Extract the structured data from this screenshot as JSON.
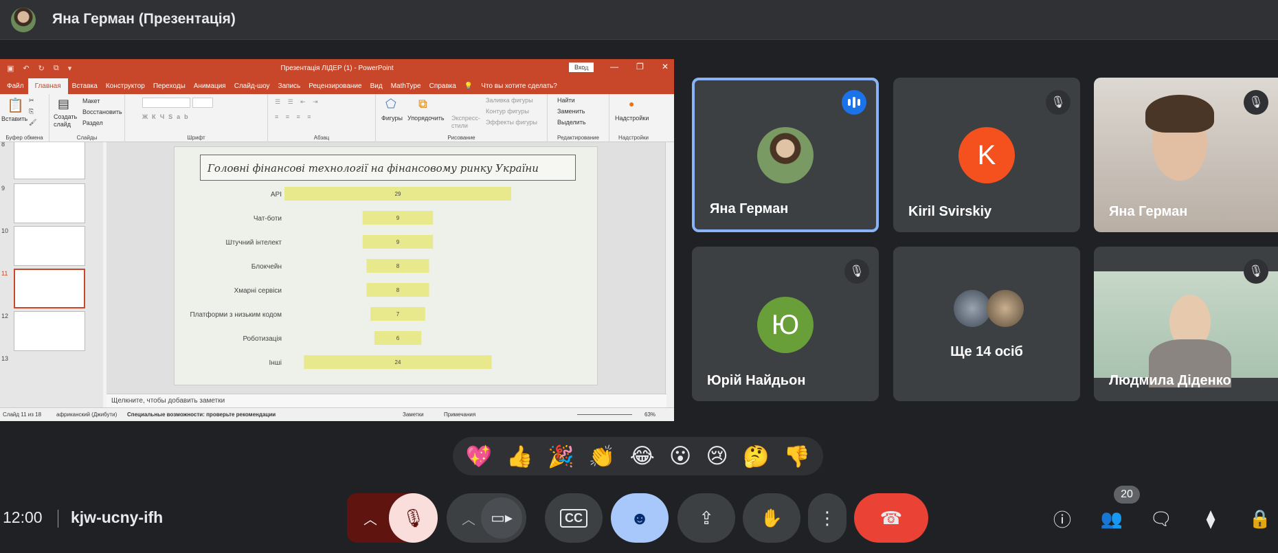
{
  "presenter": {
    "title": "Яна Герман (Презентація)"
  },
  "ppt": {
    "window_title": "Презентація ЛІДЕР (1)  -  PowerPoint",
    "signin": "Вход",
    "tabs": [
      "Файл",
      "Главная",
      "Вставка",
      "Конструктор",
      "Переходы",
      "Анимация",
      "Слайд-шоу",
      "Запись",
      "Рецензирование",
      "Вид",
      "MathType",
      "Справка",
      "Что вы хотите сделать?"
    ],
    "ribbon": {
      "paste": "Вставить",
      "clipboard": "Буфер обмена",
      "new_slide": "Создать слайд",
      "layout": "Макет",
      "reset": "Восстановить",
      "section": "Раздел",
      "slides": "Слайды",
      "font": "Шрифт",
      "paragraph": "Абзац",
      "shapes": "Фигуры",
      "arrange": "Упорядочить",
      "quick_styles": "Экспресс-стили",
      "shape_fill": "Заливка фигуры",
      "shape_outline": "Контур фигуры",
      "shape_effects": "Эффекты фигуры",
      "drawing": "Рисование",
      "find": "Найти",
      "replace": "Заменить",
      "select": "Выделить",
      "editing": "Редактирование",
      "addins_btn": "Надстройки",
      "addins": "Надстройки"
    },
    "thumb_numbers": [
      "8",
      "9",
      "10",
      "11",
      "12",
      "13"
    ],
    "notes": "Щелкните, чтобы добавить заметки",
    "status": {
      "slide": "Слайд 11 из 18",
      "lang": "африканский (Джибути)",
      "accessibility": "Специальные возможности: проверьте рекомендации",
      "notes_btn": "Заметки",
      "comments_btn": "Примечания",
      "zoom": "63%"
    }
  },
  "chart_data": {
    "type": "bar",
    "title": "Головні фінансові технології на фінансовому ринку України",
    "categories": [
      "API",
      "Чат-боти",
      "Штучний інтелект",
      "Блокчейн",
      "Хмарні сервіси",
      "Платформи з низьким кодом",
      "Роботизація",
      "Інші"
    ],
    "values": [
      29,
      9,
      9,
      8,
      8,
      7,
      6,
      24
    ],
    "orientation": "horizontal-centered",
    "bar_color": "#e8e88c"
  },
  "participants": [
    {
      "name": "Яна Герман",
      "state": "speaking",
      "avatar": "photo"
    },
    {
      "name": "Kiril Svirskiy",
      "state": "muted",
      "avatar_letter": "K",
      "avatar_color": "#f4511e"
    },
    {
      "name": "Яна Герман",
      "state": "muted",
      "avatar": "video"
    },
    {
      "name": "Юрій Найдьон",
      "state": "muted",
      "avatar_letter": "Ю",
      "avatar_color": "#689f38"
    },
    {
      "name": "Ще 14 осіб",
      "state": "overflow"
    },
    {
      "name": "Людмила Діденко",
      "state": "muted",
      "avatar": "video"
    }
  ],
  "reactions": [
    "💖",
    "👍",
    "🎉",
    "👏",
    "😂",
    "😮",
    "😢",
    "🤔",
    "👎"
  ],
  "meeting": {
    "time": "12:00",
    "code": "kjw-ucny-ifh",
    "participant_count": "20"
  },
  "colors": {
    "background": "#202124",
    "end_call": "#ea4335",
    "mic_off_bg": "#f9dedc",
    "reactions_active": "#a8c7fa"
  }
}
